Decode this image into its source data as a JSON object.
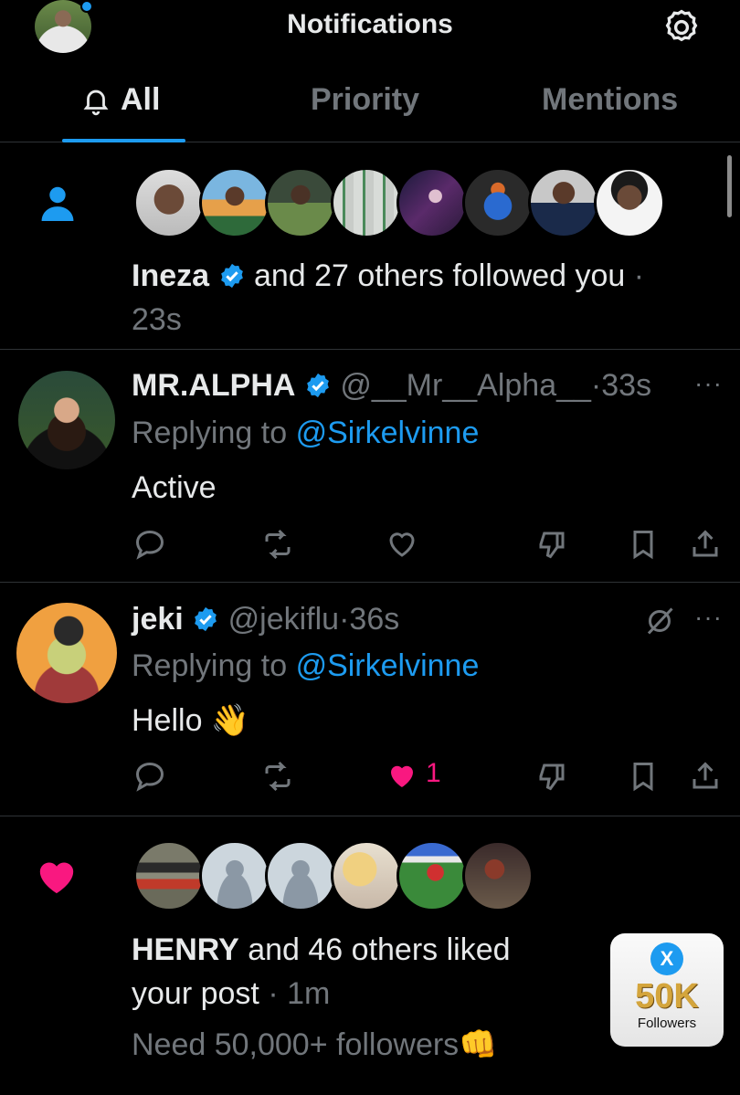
{
  "header": {
    "title": "Notifications"
  },
  "tabs": [
    {
      "label": "All"
    },
    {
      "label": "Priority"
    },
    {
      "label": "Mentions"
    }
  ],
  "follow_notification": {
    "name": "Ineza",
    "text": "and 27 others followed you",
    "sep": "·",
    "time": "23s"
  },
  "reply1": {
    "name": "MR.ALPHA",
    "handle": "@__Mr__Alpha__",
    "sep": "·",
    "time": "33s",
    "replying_label": "Replying to",
    "replying_to": "@Sirkelvinne",
    "text": "Active"
  },
  "reply2": {
    "name": "jeki",
    "handle": "@jekiflu",
    "sep": "·",
    "time": "36s",
    "replying_label": "Replying to",
    "replying_to": "@Sirkelvinne",
    "text": "Hello 👋",
    "like_count": "1"
  },
  "like_notification": {
    "name": "HENRY",
    "text": "and 46 others liked",
    "text2": "your post",
    "sep": "·",
    "time": "1m",
    "quote": "Need 50,000+ followers👊"
  },
  "badge": {
    "x": "X",
    "count": "50K",
    "label": "Followers"
  },
  "colors": {
    "accent": "#1d9bf0",
    "like": "#f91880",
    "muted": "#71767b",
    "background": "#000000"
  }
}
